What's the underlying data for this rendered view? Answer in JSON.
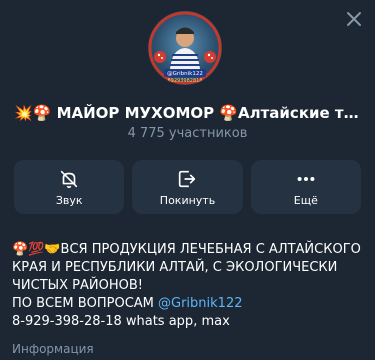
{
  "header": {
    "title": "💥🍄 МАЙОР МУХОМОР 🍄Алтайские товары...",
    "members": "4 775 участников"
  },
  "avatar": {
    "badge_text": "@Gribnik122",
    "phone_text": "89293982818",
    "colors": {
      "ring": "#c0392b",
      "badge": "#1e3a8a"
    }
  },
  "actions": [
    {
      "label": "Звук",
      "icon": "bell-off-icon"
    },
    {
      "label": "Покинуть",
      "icon": "exit-icon"
    },
    {
      "label": "Ещё",
      "icon": "more-icon"
    }
  ],
  "description": {
    "line1": "🍄💯🤝ВСЯ ПРОДУКЦИЯ  ЛЕЧЕБНАЯ С АЛТАЙСКОГО",
    "line2": "КРАЯ И РЕСПУБЛИКИ АЛТАЙ, С ЭКОЛОГИЧЕСКИ",
    "line3": "ЧИСТЫХ РАЙОНОВ!",
    "line4_prefix": "ПО ВСЕМ ВОПРОСАМ ",
    "line4_link": "@Gribnik122",
    "line5": "8-929-398-28-18 whats app, max"
  },
  "info_label": "Информация",
  "colors": {
    "background": "#1c2733",
    "button_bg": "#243241",
    "muted": "#8596a8",
    "link": "#5eb5f7"
  }
}
